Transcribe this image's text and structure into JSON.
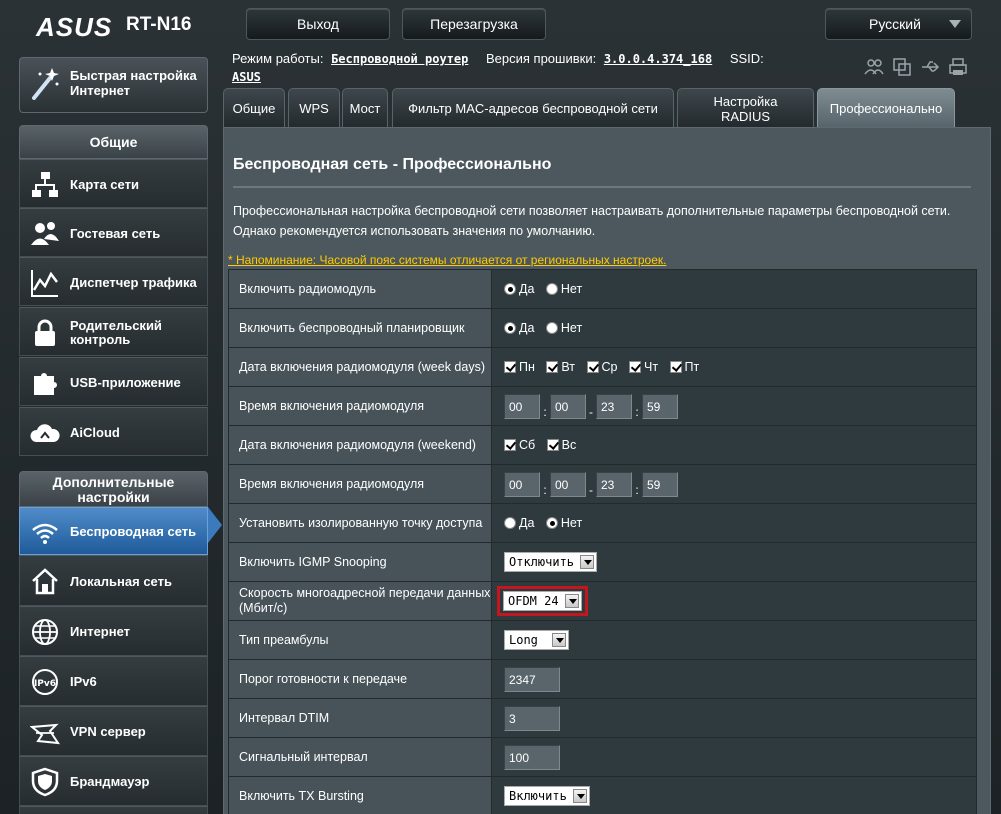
{
  "brand": {
    "logo": "ASUS",
    "model": "RT-N16"
  },
  "top_buttons": {
    "logout": "Выход",
    "reboot": "Перезагрузка",
    "language": "Русский"
  },
  "sidebar": {
    "quick_setup": "Быстрая настройка Интернет",
    "general_header": "Общие",
    "general_items": [
      {
        "label": "Карта сети",
        "icon": "network-map-icon"
      },
      {
        "label": "Гостевая сеть",
        "icon": "guest-network-icon"
      },
      {
        "label": "Диспетчер трафика",
        "icon": "traffic-manager-icon"
      },
      {
        "label": "Родительский контроль",
        "icon": "parental-control-icon"
      },
      {
        "label": "USB-приложение",
        "icon": "usb-app-icon"
      },
      {
        "label": "AiCloud",
        "icon": "aicloud-icon"
      }
    ],
    "advanced_header": "Дополнительные настройки",
    "advanced_items": [
      {
        "label": "Беспроводная сеть",
        "icon": "wireless-icon",
        "active": true
      },
      {
        "label": "Локальная сеть",
        "icon": "lan-icon"
      },
      {
        "label": "Интернет",
        "icon": "globe-icon"
      },
      {
        "label": "IPv6",
        "icon": "ipv6-icon"
      },
      {
        "label": "VPN сервер",
        "icon": "vpn-icon"
      },
      {
        "label": "Брандмауэр",
        "icon": "firewall-icon"
      }
    ]
  },
  "info": {
    "mode_label": "Режим работы:",
    "mode_value": "Беспроводной роутер",
    "firmware_label": "Версия прошивки:",
    "firmware_value": "3.0.0.4.374_168",
    "ssid_label": "SSID:",
    "ssid_value": "ASUS"
  },
  "tabs": [
    {
      "label": "Общие"
    },
    {
      "label": "WPS"
    },
    {
      "label": "Мост"
    },
    {
      "label": "Фильтр MAC-адресов беспроводной сети"
    },
    {
      "label": "Настройка RADIUS"
    },
    {
      "label": "Профессионально",
      "active": true
    }
  ],
  "page": {
    "title": "Беспроводная сеть - Профессионально",
    "description": "Профессиональная настройка беспроводной сети позволяет настраивать дополнительные параметры беспроводной сети. Однако рекомендуется использовать значения по умолчанию.",
    "reminder": "* Напоминание: Часовой пояс системы отличается от региональных настроек."
  },
  "settings": {
    "radio_enable": {
      "label": "Включить радиомодуль",
      "yes": "Да",
      "no": "Нет",
      "selected": "yes"
    },
    "scheduler": {
      "label": "Включить беспроводный планировщик",
      "yes": "Да",
      "no": "Нет",
      "selected": "yes"
    },
    "weekdays": {
      "label": "Дата включения радиомодуля (week days)",
      "days": [
        "Пн",
        "Вт",
        "Ср",
        "Чт",
        "Пт"
      ]
    },
    "weekday_time": {
      "label": "Время включения радиомодуля",
      "start_h": "00",
      "start_m": "00",
      "end_h": "23",
      "end_m": "59"
    },
    "weekend": {
      "label": "Дата включения радиомодуля (weekend)",
      "days": [
        "Сб",
        "Вс"
      ]
    },
    "weekend_time": {
      "label": "Время включения радиомодуля",
      "start_h": "00",
      "start_m": "00",
      "end_h": "23",
      "end_m": "59"
    },
    "isolation": {
      "label": "Установить изолированную точку доступа",
      "yes": "Да",
      "no": "Нет",
      "selected": "no"
    },
    "igmp": {
      "label": "Включить IGMP Snooping",
      "value": "Отключить"
    },
    "multicast": {
      "label": "Скорость многоадресной передачи данных (Мбит/с)",
      "value": "OFDM 24"
    },
    "preamble": {
      "label": "Тип преамбулы",
      "value": "Long"
    },
    "rts": {
      "label": "Порог готовности к передаче",
      "value": "2347"
    },
    "dtim": {
      "label": "Интервал DTIM",
      "value": "3"
    },
    "beacon": {
      "label": "Сигнальный интервал",
      "value": "100"
    },
    "tx_burst": {
      "label": "Включить TX Bursting",
      "value": "Включить"
    }
  },
  "colors": {
    "accent": "#3b7bbd",
    "highlight": "#c4161c",
    "reminder": "#ffcc00"
  }
}
